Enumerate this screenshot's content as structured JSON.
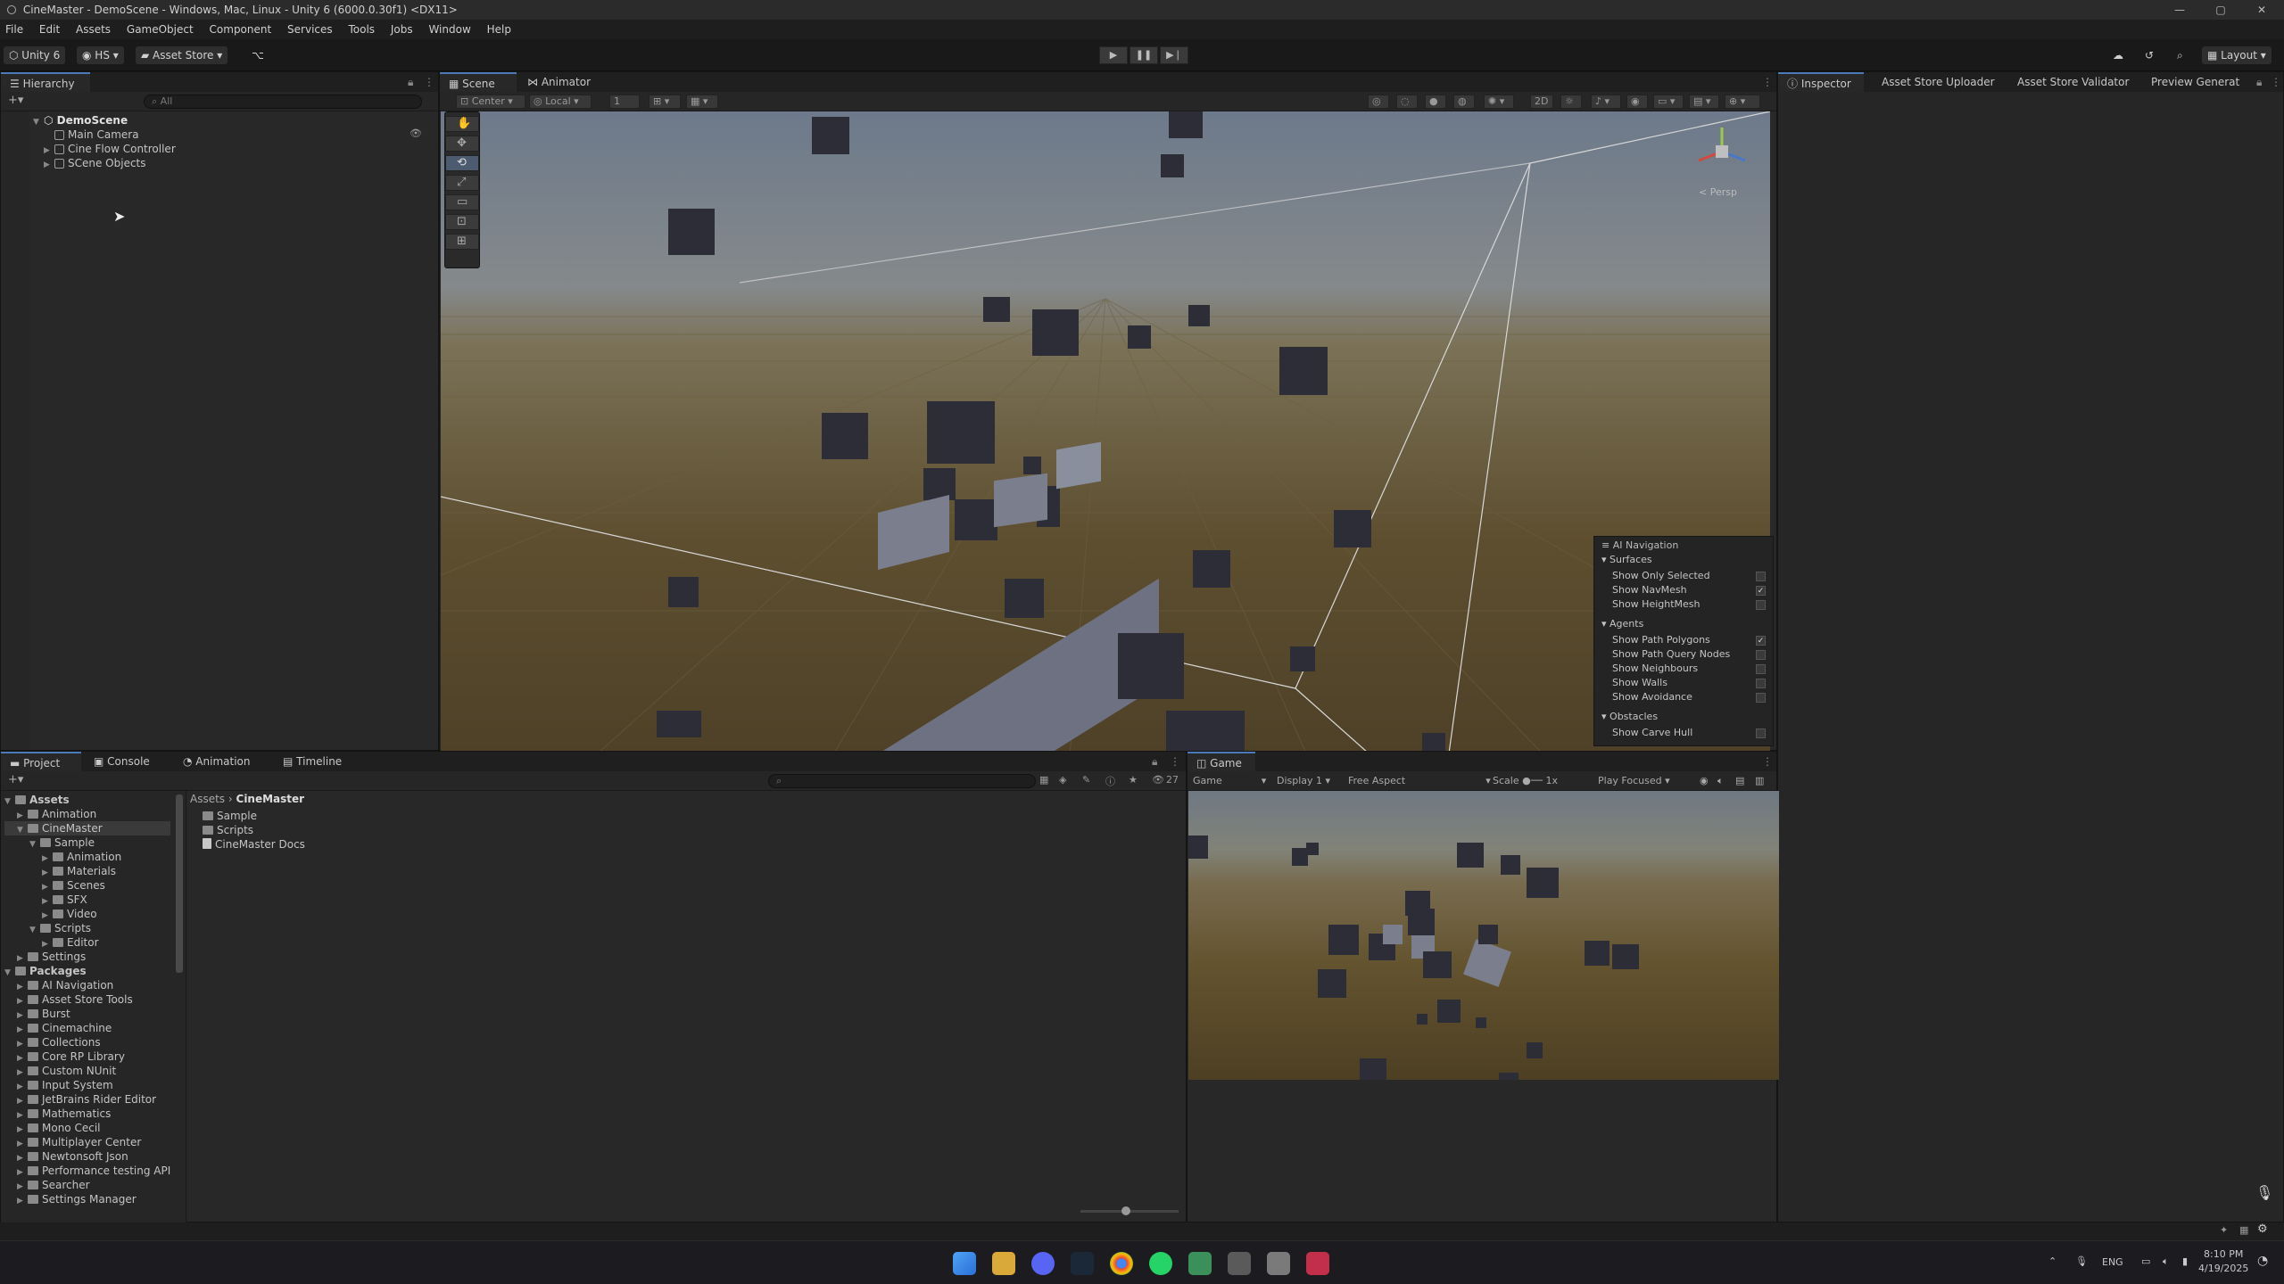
{
  "window": {
    "title": "CineMaster - DemoScene - Windows, Mac, Linux - Unity 6 (6000.0.30f1) <DX11>",
    "controls": [
      "—",
      "▢",
      "✕"
    ]
  },
  "menu": [
    "File",
    "Edit",
    "Assets",
    "GameObject",
    "Component",
    "Services",
    "Tools",
    "Jobs",
    "Window",
    "Help"
  ],
  "toolbar": {
    "unity_label": "Unity 6",
    "account": "HS",
    "asset_store": "Asset Store",
    "layout": "Layout"
  },
  "hierarchy": {
    "tab": "Hierarchy",
    "search_placeholder": "All",
    "scene": "DemoScene",
    "items": [
      "Main Camera",
      "Cine Flow Controller",
      "SCene Objects"
    ]
  },
  "scene_tabs": {
    "scene": "Scene",
    "animator": "Animator"
  },
  "scene_toolbar": {
    "pivot": "Center",
    "space": "Local",
    "grid_value": "1",
    "mode_2d": "2D",
    "persp": "< Persp"
  },
  "ai_navigation": {
    "title": "AI Navigation",
    "surfaces": {
      "header": "Surfaces",
      "rows": [
        {
          "label": "Show Only Selected",
          "checked": false
        },
        {
          "label": "Show NavMesh",
          "checked": true
        },
        {
          "label": "Show HeightMesh",
          "checked": false
        }
      ]
    },
    "agents": {
      "header": "Agents",
      "rows": [
        {
          "label": "Show Path Polygons",
          "checked": true
        },
        {
          "label": "Show Path Query Nodes",
          "checked": false
        },
        {
          "label": "Show Neighbours",
          "checked": false
        },
        {
          "label": "Show Walls",
          "checked": false
        },
        {
          "label": "Show Avoidance",
          "checked": false
        }
      ]
    },
    "obstacles": {
      "header": "Obstacles",
      "rows": [
        {
          "label": "Show Carve Hull",
          "checked": false
        }
      ]
    }
  },
  "inspector_tabs": [
    "Inspector",
    "Asset Store Uploader",
    "Asset Store Validator",
    "Preview Generat"
  ],
  "bottom_tabs": [
    "Project",
    "Console",
    "Animation",
    "Timeline"
  ],
  "project": {
    "breadcrumb": [
      "Assets",
      "CineMaster"
    ],
    "hidden_count": "27",
    "tree": [
      {
        "label": "Assets",
        "depth": 0,
        "bold": true
      },
      {
        "label": "Animation",
        "depth": 1
      },
      {
        "label": "CineMaster",
        "depth": 1,
        "selected": true
      },
      {
        "label": "Sample",
        "depth": 2
      },
      {
        "label": "Animation",
        "depth": 3
      },
      {
        "label": "Materials",
        "depth": 3
      },
      {
        "label": "Scenes",
        "depth": 3
      },
      {
        "label": "SFX",
        "depth": 3
      },
      {
        "label": "Video",
        "depth": 3
      },
      {
        "label": "Scripts",
        "depth": 2
      },
      {
        "label": "Editor",
        "depth": 3
      },
      {
        "label": "Settings",
        "depth": 1
      },
      {
        "label": "Packages",
        "depth": 0,
        "bold": true
      },
      {
        "label": "AI Navigation",
        "depth": 1
      },
      {
        "label": "Asset Store Tools",
        "depth": 1
      },
      {
        "label": "Burst",
        "depth": 1
      },
      {
        "label": "Cinemachine",
        "depth": 1
      },
      {
        "label": "Collections",
        "depth": 1
      },
      {
        "label": "Core RP Library",
        "depth": 1
      },
      {
        "label": "Custom NUnit",
        "depth": 1
      },
      {
        "label": "Input System",
        "depth": 1
      },
      {
        "label": "JetBrains Rider Editor",
        "depth": 1
      },
      {
        "label": "Mathematics",
        "depth": 1
      },
      {
        "label": "Mono Cecil",
        "depth": 1
      },
      {
        "label": "Multiplayer Center",
        "depth": 1
      },
      {
        "label": "Newtonsoft Json",
        "depth": 1
      },
      {
        "label": "Performance testing API",
        "depth": 1
      },
      {
        "label": "Searcher",
        "depth": 1
      },
      {
        "label": "Settings Manager",
        "depth": 1
      }
    ],
    "contents": [
      "Sample",
      "Scripts",
      "CineMaster Docs"
    ]
  },
  "game": {
    "tab": "Game",
    "mode": "Game",
    "display": "Display 1",
    "aspect": "Free Aspect",
    "scale_label": "Scale",
    "scale_value": "1x",
    "play_mode": "Play Focused"
  },
  "taskbar": {
    "language": "ENG",
    "time": "8:10 PM",
    "date": "4/19/2025"
  }
}
